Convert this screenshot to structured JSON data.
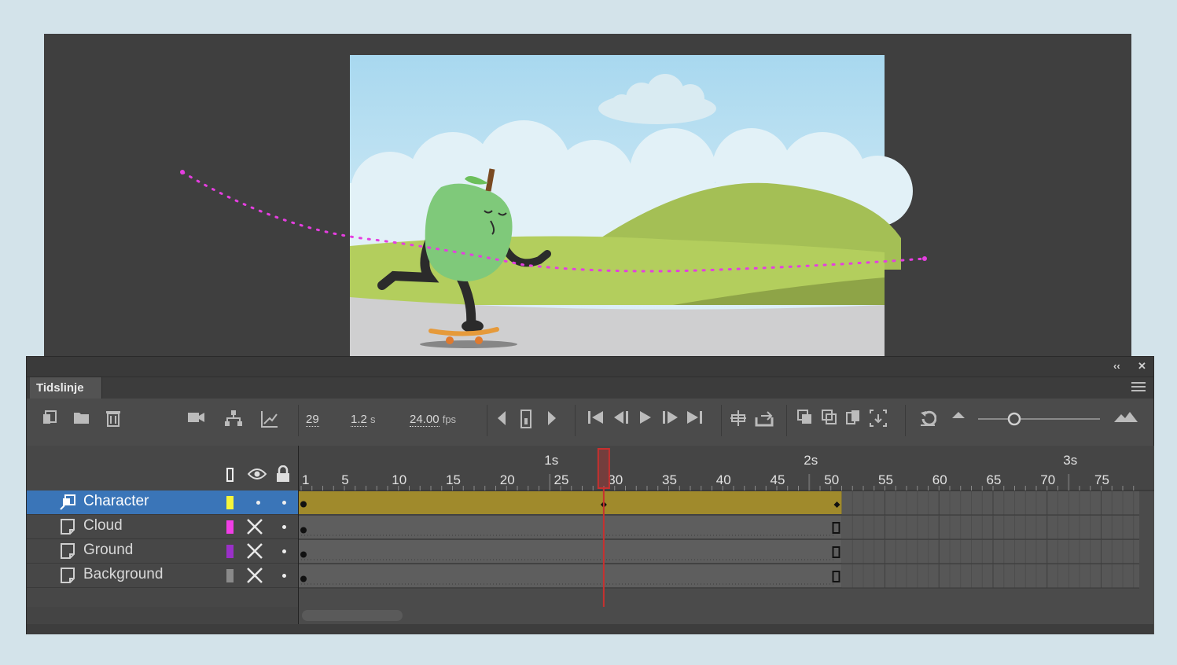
{
  "panel": {
    "title": "Tidslinje",
    "collapse_glyph": "‹‹",
    "close_glyph": "✕"
  },
  "toolbar": {
    "current_frame": "29",
    "elapsed_value": "1.2",
    "elapsed_unit": "s",
    "fps_value": "24.00",
    "fps_unit": "fps"
  },
  "layers": [
    {
      "name": "Character",
      "color": "#f5f53a",
      "selected": true,
      "icon": "motion-tween-layer-icon",
      "visible": true
    },
    {
      "name": "Cloud",
      "color": "#f13ee6",
      "selected": false,
      "icon": "layer-page-icon",
      "visible": false
    },
    {
      "name": "Ground",
      "color": "#9a30c8",
      "selected": false,
      "icon": "layer-page-icon",
      "visible": false
    },
    {
      "name": "Background",
      "color": "#8a8a8a",
      "selected": false,
      "icon": "layer-page-icon",
      "visible": false
    }
  ],
  "ruler": {
    "seconds": [
      "1s",
      "2s",
      "3s"
    ],
    "frame_labels": [
      "1",
      "5",
      "10",
      "15",
      "20",
      "25",
      "30",
      "35",
      "40",
      "45",
      "50",
      "55",
      "60",
      "65",
      "70",
      "75"
    ]
  },
  "timeline": {
    "playhead_frame": 29,
    "tween_end_frame": 51,
    "tween_color": "#a08a2c",
    "playhead_color": "#c8302f"
  },
  "icons": {
    "new-layer": "new-layer-icon",
    "new-folder": "folder-icon",
    "delete": "trash-icon",
    "camera": "camera-icon",
    "parent": "hierarchy-icon",
    "graph": "graph-icon"
  }
}
